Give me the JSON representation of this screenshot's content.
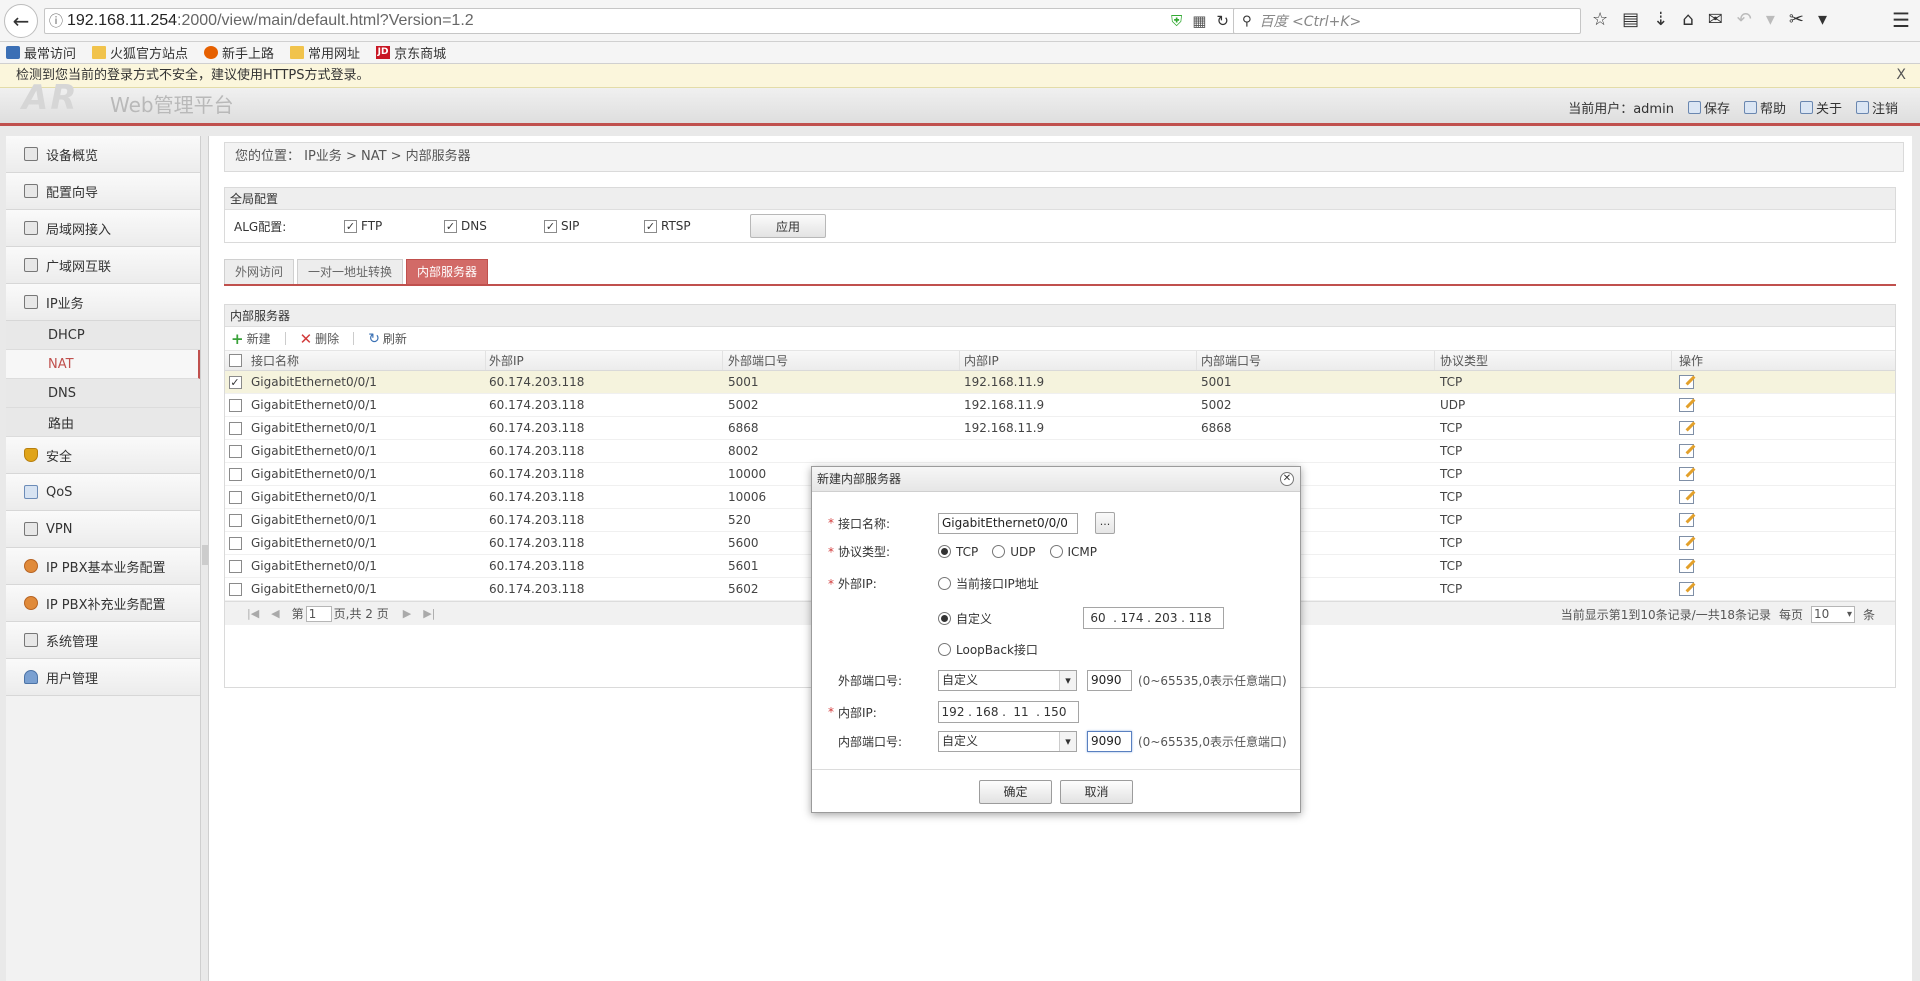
{
  "browser": {
    "url_host": "192.168.11.254",
    "url_rest": ":2000/view/main/default.html?Version=1.2",
    "search_placeholder": "百度 <Ctrl+K>",
    "bookmarks": [
      "最常访问",
      "火狐官方站点",
      "新手上路",
      "常用网址",
      "京东商城"
    ],
    "jd_logo": "JD"
  },
  "notice": {
    "text": "检测到您当前的登录方式不安全，建议使用HTTPS方式登录。",
    "close": "X"
  },
  "header": {
    "logo": "AR",
    "title": "Web管理平台",
    "current_user": "当前用户：admin",
    "save": "保存",
    "help": "帮助",
    "about": "关于",
    "logout": "注销"
  },
  "sidebar": {
    "items": [
      "设备概览",
      "配置向导",
      "局域网接入",
      "广域网互联",
      "IP业务"
    ],
    "sub_items": [
      "DHCP",
      "NAT",
      "DNS",
      "路由"
    ],
    "items_after": [
      "安全",
      "QoS",
      "VPN",
      "IP PBX基本业务配置",
      "IP PBX补充业务配置",
      "系统管理",
      "用户管理"
    ]
  },
  "breadcrumb": "您的位置： IP业务 > NAT > 内部服务器",
  "global_config": {
    "title": "全局配置",
    "alg_label": "ALG配置:",
    "options": [
      {
        "label": "FTP",
        "checked": true
      },
      {
        "label": "DNS",
        "checked": true
      },
      {
        "label": "SIP",
        "checked": true
      },
      {
        "label": "RTSP",
        "checked": true
      }
    ],
    "apply": "应用"
  },
  "tabs": [
    "外网访问",
    "一对一地址转换",
    "内部服务器"
  ],
  "server_table": {
    "title": "内部服务器",
    "toolbar": {
      "new": "新建",
      "delete": "删除",
      "refresh": "刷新"
    },
    "columns": [
      "接口名称",
      "外部IP",
      "外部端口号",
      "内部IP",
      "内部端口号",
      "协议类型",
      "操作"
    ],
    "rows": [
      {
        "iface": "GigabitEthernet0/0/1",
        "ext_ip": "60.174.203.118",
        "ext_port": "5001",
        "int_ip": "192.168.11.9",
        "int_port": "5001",
        "proto": "TCP",
        "checked": true
      },
      {
        "iface": "GigabitEthernet0/0/1",
        "ext_ip": "60.174.203.118",
        "ext_port": "5002",
        "int_ip": "192.168.11.9",
        "int_port": "5002",
        "proto": "UDP",
        "checked": false
      },
      {
        "iface": "GigabitEthernet0/0/1",
        "ext_ip": "60.174.203.118",
        "ext_port": "6868",
        "int_ip": "192.168.11.9",
        "int_port": "6868",
        "proto": "TCP",
        "checked": false
      },
      {
        "iface": "GigabitEthernet0/0/1",
        "ext_ip": "60.174.203.118",
        "ext_port": "8002",
        "int_ip": "",
        "int_port": "",
        "proto": "TCP",
        "checked": false
      },
      {
        "iface": "GigabitEthernet0/0/1",
        "ext_ip": "60.174.203.118",
        "ext_port": "10000",
        "int_ip": "",
        "int_port": "",
        "proto": "TCP",
        "checked": false
      },
      {
        "iface": "GigabitEthernet0/0/1",
        "ext_ip": "60.174.203.118",
        "ext_port": "10006",
        "int_ip": "",
        "int_port": "",
        "proto": "TCP",
        "checked": false
      },
      {
        "iface": "GigabitEthernet0/0/1",
        "ext_ip": "60.174.203.118",
        "ext_port": "520",
        "int_ip": "",
        "int_port": "",
        "proto": "TCP",
        "checked": false
      },
      {
        "iface": "GigabitEthernet0/0/1",
        "ext_ip": "60.174.203.118",
        "ext_port": "5600",
        "int_ip": "",
        "int_port": "",
        "proto": "TCP",
        "checked": false
      },
      {
        "iface": "GigabitEthernet0/0/1",
        "ext_ip": "60.174.203.118",
        "ext_port": "5601",
        "int_ip": "",
        "int_port": "",
        "proto": "TCP",
        "checked": false
      },
      {
        "iface": "GigabitEthernet0/0/1",
        "ext_ip": "60.174.203.118",
        "ext_port": "5602",
        "int_ip": "",
        "int_port": "",
        "proto": "TCP",
        "checked": false
      }
    ],
    "pager": {
      "page_prefix": "第",
      "page": "1",
      "page_suffix": "页,共 2 页",
      "summary": "当前显示第1到10条记录/一共18条记录",
      "per_page_label": "每页",
      "per_page": "10",
      "per_page_unit": "条"
    }
  },
  "dialog": {
    "title": "新建内部服务器",
    "iface_label": "接口名称:",
    "iface_value": "GigabitEthernet0/0/0",
    "browse": "...",
    "proto_label": "协议类型:",
    "proto_options": [
      "TCP",
      "UDP",
      "ICMP"
    ],
    "proto_selected": "TCP",
    "ext_ip_label": "外部IP:",
    "ext_ip_options": [
      "当前接口IP地址",
      "自定义",
      "LoopBack接口"
    ],
    "ext_ip_selected": "自定义",
    "ext_ip": [
      "60",
      "174",
      "203",
      "118"
    ],
    "ext_port_label": "外部端口号:",
    "ext_port_mode": "自定义",
    "ext_port": "9090",
    "port_hint": "(0~65535,0表示任意端口)",
    "int_ip_label": "内部IP:",
    "int_ip": [
      "192",
      "168",
      "11",
      "150"
    ],
    "int_port_label": "内部端口号:",
    "int_port_mode": "自定义",
    "int_port": "9090",
    "ok": "确定",
    "cancel": "取消"
  }
}
